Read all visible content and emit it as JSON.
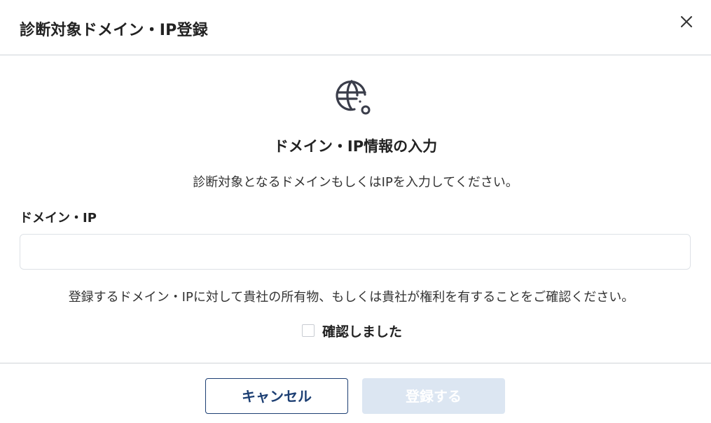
{
  "dialog": {
    "title": "診断対象ドメイン・IP登録",
    "close_icon": "close-icon"
  },
  "content": {
    "icon": "globe-icon",
    "section_title": "ドメイン・IP情報の入力",
    "description": "診断対象となるドメインもしくはIPを入力してください。"
  },
  "form": {
    "label": "ドメイン・IP",
    "value": "",
    "placeholder": ""
  },
  "confirmation": {
    "notice": "登録するドメイン・IPに対して貴社の所有物、もしくは貴社が権利を有することをご確認ください。",
    "checkbox_label": "確認しました",
    "checked": false
  },
  "footer": {
    "cancel_label": "キャンセル",
    "submit_label": "登録する",
    "submit_disabled": true
  },
  "colors": {
    "primary": "#1d3f73",
    "disabled_button": "#dce6f2",
    "divider": "#cfd3d8",
    "icon": "#3a3d4a"
  }
}
